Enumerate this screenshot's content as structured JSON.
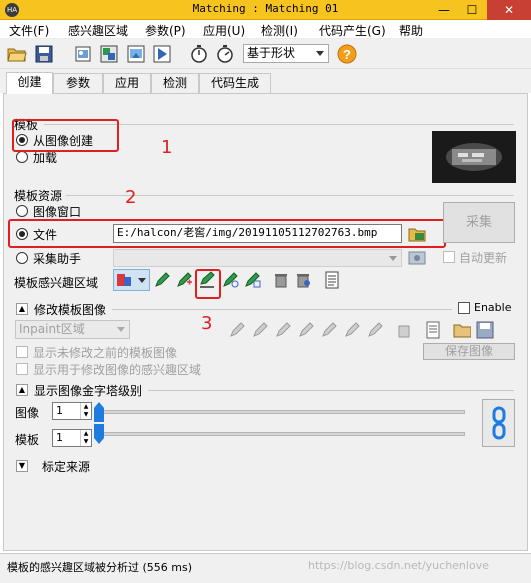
{
  "window": {
    "title": "Matching : Matching 01",
    "app_icon": "HA"
  },
  "menu": [
    "文件(F)",
    "感兴趣区域",
    "参数(P)",
    "应用(U)",
    "检测(I)",
    "代码产生(G)",
    "帮助"
  ],
  "toolbar": {
    "shape_select": "基于形状"
  },
  "tabs": [
    "创建",
    "参数",
    "应用",
    "检测",
    "代码生成"
  ],
  "template": {
    "section_label": "模板",
    "from_image": "从图像创建",
    "load": "加载"
  },
  "source": {
    "section_label": "模板资源",
    "image_window": "图像窗口",
    "file": "文件",
    "file_path": "E:/halcon/老窖/img/20191105112702763.bmp",
    "acquire_helper": "采集助手",
    "acquire_button": "采集",
    "auto_update": "自动更新"
  },
  "roi": {
    "label": "模板感兴趣区域"
  },
  "modify": {
    "section_label": "修改模板图像",
    "enable": "Enable",
    "inpaint": "Inpaint区域",
    "show_unmodified": "显示未修改之前的模板图像",
    "show_roi": "显示用于修改图像的感兴趣区域",
    "save_image": "保存图像"
  },
  "pyramid": {
    "section_label": "显示图像金字塔级别",
    "image_label": "图像",
    "image_value": "1",
    "template_label": "模板",
    "template_value": "1"
  },
  "calibration": {
    "section_label": "标定来源"
  },
  "annotations": {
    "n1": "1",
    "n2": "2",
    "n3": "3"
  },
  "status": {
    "text": "模板的感兴趣区域被分析过 (556 ms)",
    "watermark": "https://blog.csdn.net/yuchenlove"
  },
  "colors": {
    "titlebar": "#f6c31f",
    "close": "#c74033",
    "annotation": "#e02020"
  }
}
